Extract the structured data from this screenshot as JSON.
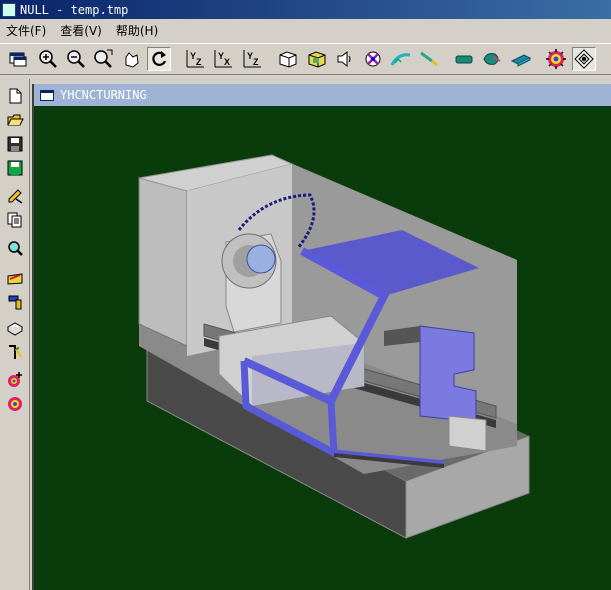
{
  "window": {
    "title": "NULL - temp.tmp"
  },
  "menu": {
    "items": [
      "文件(F)",
      "查看(V)",
      "帮助(H)"
    ]
  },
  "toolbar": {
    "buttons": [
      "new-window-icon",
      "zoom-in-icon",
      "zoom-out-icon",
      "zoom-window-icon",
      "pan-icon",
      "rotate-icon",
      "view-yz-icon",
      "view-yx-icon",
      "view-xz-icon",
      "view-iso-1-icon",
      "view-iso-2-icon",
      "sound-icon",
      "axis-icon",
      "tool-path-icon",
      "tool-icon",
      "shape-1-icon",
      "shape-2-icon",
      "shape-3-icon",
      "gear-1-icon",
      "gear-2-icon"
    ],
    "axis_labels": {
      "yz": "Y Z",
      "yx": "Y X",
      "xz": "Y Z"
    }
  },
  "left_toolbar": {
    "buttons": [
      "new-file-icon",
      "open-file-icon",
      "save-icon",
      "save-as-icon",
      "edit-icon",
      "copy-icon",
      "search-icon",
      "open-program-icon",
      "tool-select-icon",
      "workpiece-icon",
      "measure-icon",
      "add-icon",
      "settings-icon"
    ]
  },
  "document": {
    "title": "YHCNCTURNING"
  },
  "colors": {
    "viewport_bg": "#0a3b0a",
    "machine_gray": "#a8a8a8",
    "guard_blue": "#6666e0"
  }
}
